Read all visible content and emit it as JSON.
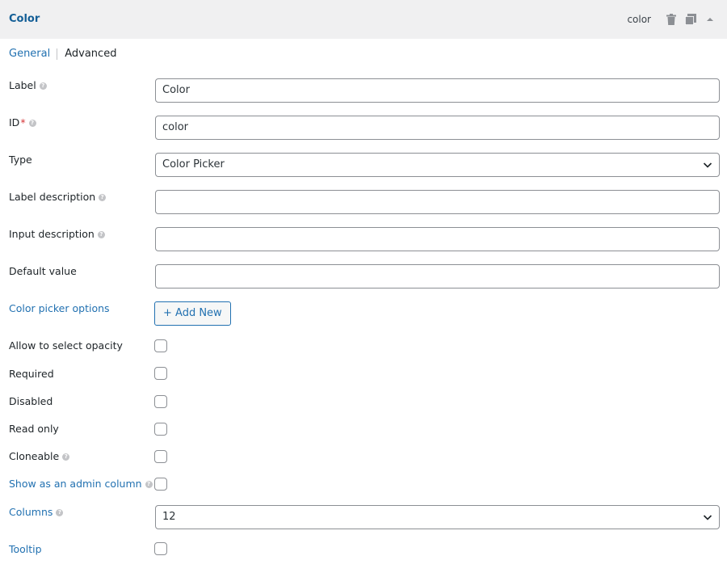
{
  "header": {
    "title": "Color",
    "slug": "color",
    "icons": [
      "trash-icon",
      "duplicate-icon",
      "collapse-arrow-icon"
    ]
  },
  "tabs": {
    "general": "General",
    "advanced": "Advanced"
  },
  "fields": {
    "label": {
      "label": "Label",
      "value": "Color"
    },
    "id": {
      "label": "ID",
      "required_mark": "*",
      "value": "color"
    },
    "type": {
      "label": "Type",
      "value": "Color Picker"
    },
    "label_description": {
      "label": "Label description",
      "value": ""
    },
    "input_description": {
      "label": "Input description",
      "value": ""
    },
    "default_value": {
      "label": "Default value",
      "value": ""
    },
    "color_picker_options": {
      "label": "Color picker options",
      "button": "+ Add New"
    },
    "allow_opacity": {
      "label": "Allow to select opacity",
      "checked": false
    },
    "required": {
      "label": "Required",
      "checked": false
    },
    "disabled": {
      "label": "Disabled",
      "checked": false
    },
    "read_only": {
      "label": "Read only",
      "checked": false
    },
    "cloneable": {
      "label": "Cloneable",
      "checked": false
    },
    "admin_column": {
      "label": "Show as an admin column",
      "checked": false
    },
    "columns": {
      "label": "Columns",
      "value": "12"
    },
    "tooltip": {
      "label": "Tooltip",
      "checked": false
    }
  },
  "colors": {
    "accent": "#2271b1",
    "header_bg": "#f0f0f1",
    "border": "#8c8f94",
    "help_icon": "#c3c4c7"
  }
}
